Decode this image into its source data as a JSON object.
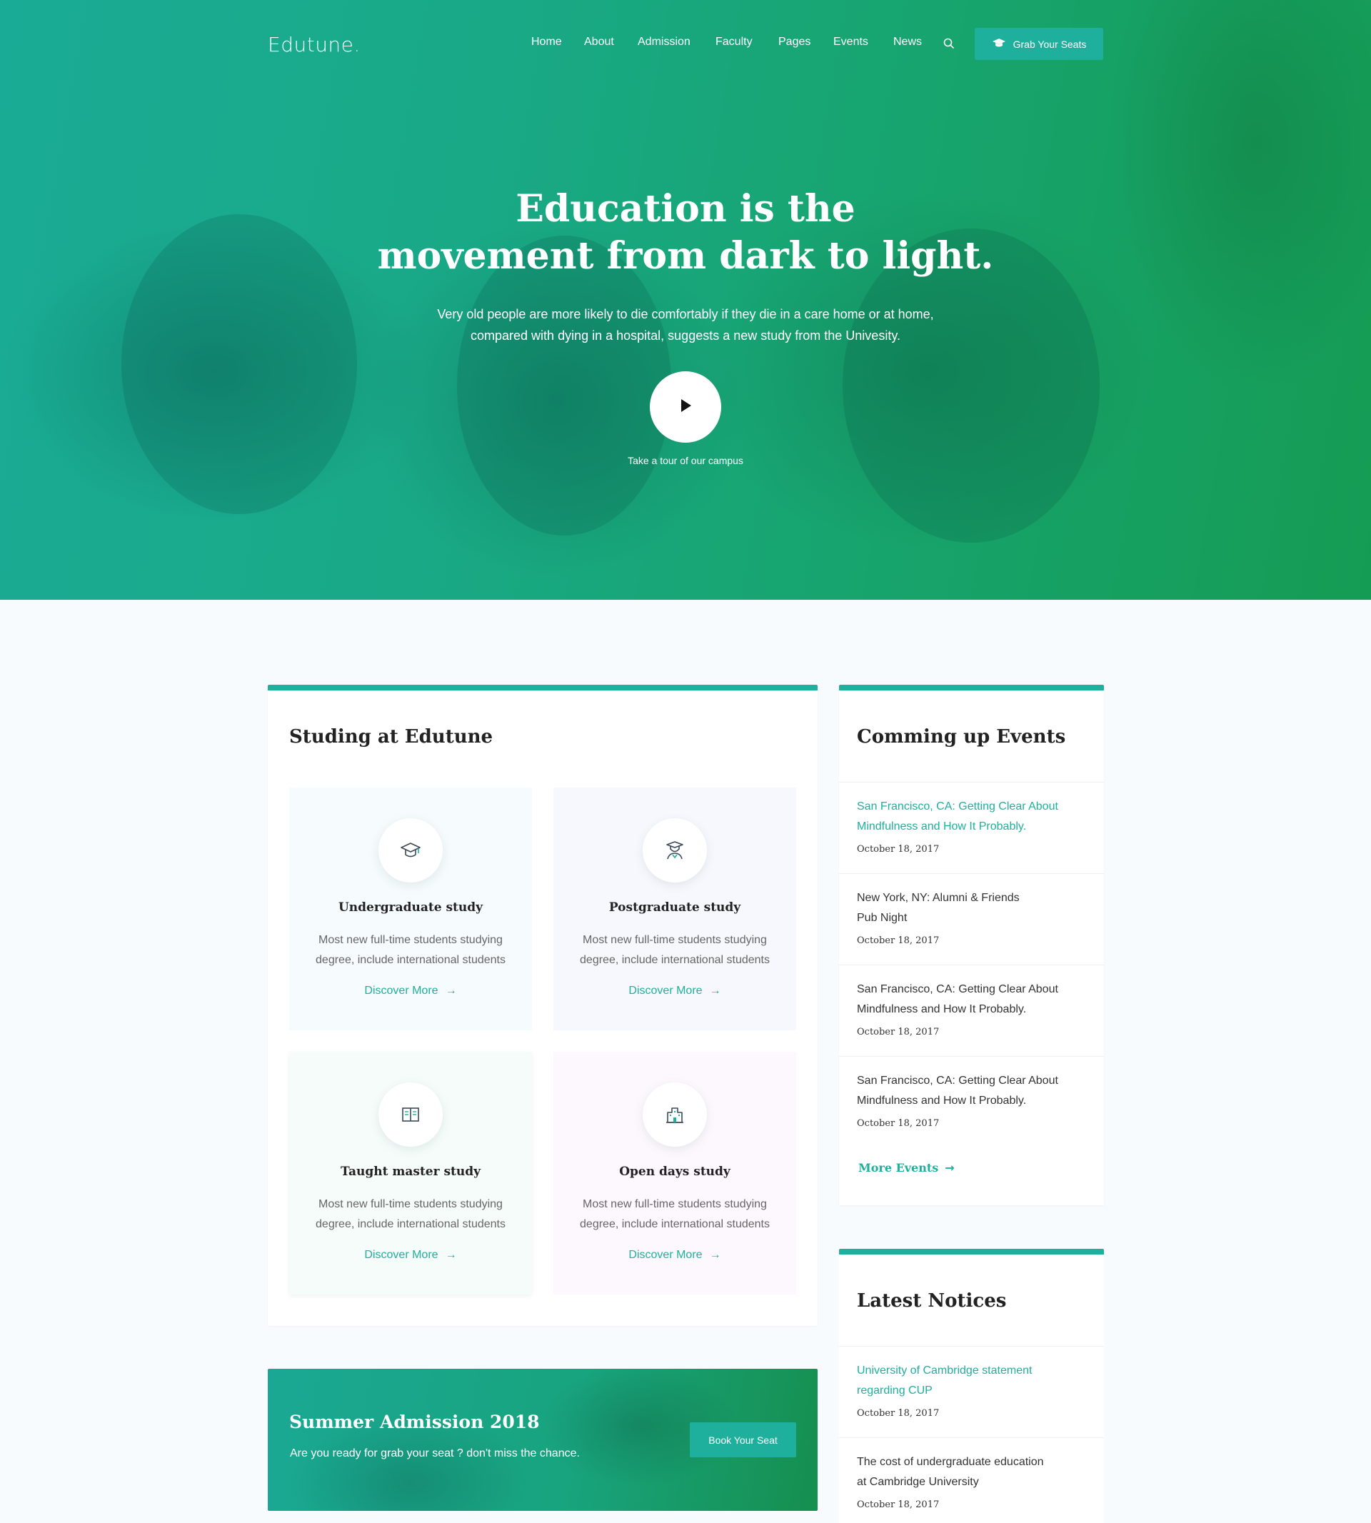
{
  "header": {
    "logo": "Edutune.",
    "nav": [
      "Home",
      "About",
      "Admission",
      "Faculty",
      "Pages",
      "Events",
      "News"
    ],
    "cta_label": "Grab Your Seats"
  },
  "hero": {
    "title_line1": "Education is the",
    "title_line2": "movement from dark to light.",
    "subtitle_line1": "Very old people are more likely to die comfortably if they die in a care home or at home,",
    "subtitle_line2": "compared with dying in a hospital, suggests a new study from the Univesity.",
    "tour_label": "Take a tour of our campus"
  },
  "study": {
    "title": "Studing at Edutune",
    "cards": [
      {
        "title": "Undergraduate study",
        "desc_line1": "Most new full-time students studying",
        "desc_line2": "degree, include international students",
        "link": "Discover More",
        "icon": "graduation-cap-icon"
      },
      {
        "title": "Postgraduate  study",
        "desc_line1": "Most new full-time students studying",
        "desc_line2": "degree, include international students",
        "link": "Discover More",
        "icon": "graduate-person-icon"
      },
      {
        "title": "Taught master study",
        "desc_line1": "Most new full-time students studying",
        "desc_line2": "degree, include international students",
        "link": "Discover More",
        "icon": "book-icon"
      },
      {
        "title": "Open days study",
        "desc_line1": "Most new full-time students studying",
        "desc_line2": "degree, include international students",
        "link": "Discover More",
        "icon": "building-icon"
      }
    ]
  },
  "admission": {
    "title": "Summer Admission 2018",
    "subtitle": "Are you ready for grab your seat ? don't miss the chance.",
    "button": "Book Your Seat"
  },
  "events": {
    "title": "Comming up Events",
    "items": [
      {
        "line1": "San Francisco, CA: Getting Clear About",
        "line2": "Mindfulness and How It Probably.",
        "date": "October 18, 2017",
        "highlight": true
      },
      {
        "line1": "New York, NY: Alumni & Friends",
        "line2": "Pub Night",
        "date": "October 18, 2017",
        "highlight": false
      },
      {
        "line1": "San Francisco, CA: Getting Clear About",
        "line2": "Mindfulness and How It Probably.",
        "date": "October 18, 2017",
        "highlight": false
      },
      {
        "line1": "San Francisco, CA: Getting Clear About",
        "line2": "Mindfulness and How It Probably.",
        "date": "October 18, 2017",
        "highlight": false
      }
    ],
    "more": "More Events"
  },
  "notices": {
    "title": "Latest Notices",
    "items": [
      {
        "line1": "University of Cambridge statement",
        "line2": "regarding CUP",
        "date": "October 18, 2017",
        "highlight": true
      },
      {
        "line1": "The cost of undergraduate education",
        "line2": "at Cambridge University",
        "date": "October 18, 2017",
        "highlight": false
      }
    ]
  },
  "colors": {
    "accent": "#1eb09c",
    "hero_start": "#1aab96",
    "hero_end": "#159c54"
  }
}
